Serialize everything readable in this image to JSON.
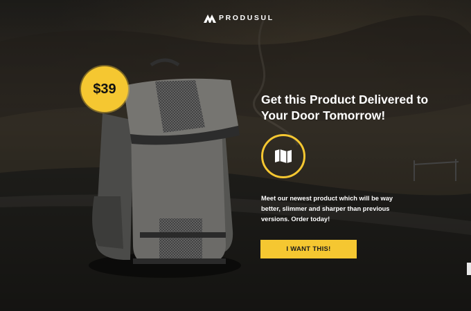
{
  "brand": {
    "name": "PRODUSUL",
    "logo_icon": "mountain-logo-icon"
  },
  "product": {
    "price": "$39",
    "image_icon": "backpack-image"
  },
  "headline": "Get this Product Delivered to Your Door Tomorrow!",
  "feature_icon": "map-icon",
  "description": "Meet our newest product which will be way better, slimmer and sharper than previous versions. Order today!",
  "cta": {
    "label": "I WANT THIS!"
  },
  "colors": {
    "accent": "#f5c731",
    "text": "#ffffff",
    "background": "#1c1b19"
  }
}
